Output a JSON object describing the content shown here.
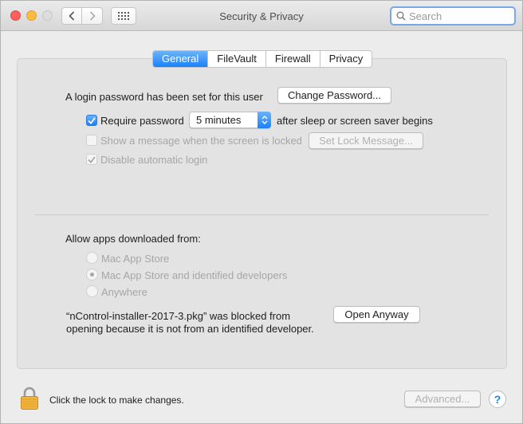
{
  "window": {
    "title": "Security & Privacy",
    "search_placeholder": "Search"
  },
  "tabs": [
    {
      "label": "General",
      "active": true
    },
    {
      "label": "FileVault",
      "active": false
    },
    {
      "label": "Firewall",
      "active": false
    },
    {
      "label": "Privacy",
      "active": false
    }
  ],
  "general": {
    "login_text": "A login password has been set for this user",
    "change_password_label": "Change Password...",
    "require_password": {
      "checked": true,
      "label": "Require password",
      "value": "5 minutes",
      "suffix": "after sleep or screen saver begins"
    },
    "show_message": {
      "checked": false,
      "label": "Show a message when the screen is locked",
      "button": "Set Lock Message..."
    },
    "disable_login": {
      "checked": true,
      "label": "Disable automatic login"
    }
  },
  "downloads": {
    "heading": "Allow apps downloaded from:",
    "options": [
      {
        "label": "Mac App Store",
        "selected": false
      },
      {
        "label": "Mac App Store and identified developers",
        "selected": true
      },
      {
        "label": "Anywhere",
        "selected": false
      }
    ],
    "blocked_line1": "“nControl-installer-2017-3.pkg” was blocked from",
    "blocked_line2": "opening because it is not from an identified developer.",
    "open_anyway_label": "Open Anyway"
  },
  "footer": {
    "lock_text": "Click the lock to make changes.",
    "advanced_label": "Advanced...",
    "help_label": "?"
  },
  "colors": {
    "accent": "#1a82fb",
    "close": "#fc605c",
    "minimize": "#fdbc40"
  }
}
